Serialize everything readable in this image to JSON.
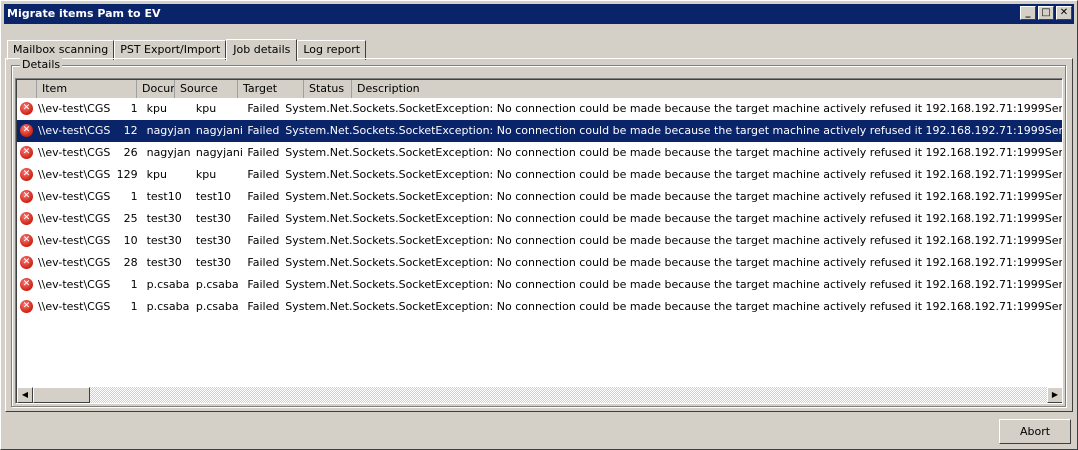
{
  "window": {
    "title": "Migrate items Pam to EV",
    "buttons": {
      "minimize": "_",
      "maximize": "□",
      "close": "✕"
    }
  },
  "tabs": [
    {
      "label": "Mailbox scanning"
    },
    {
      "label": "PST Export/Import"
    },
    {
      "label": "Job details",
      "active": true
    },
    {
      "label": "Log report"
    }
  ],
  "group": {
    "label": "Details"
  },
  "columns": [
    "",
    "Item",
    "Docur",
    "Source",
    "Target",
    "Status",
    "Description"
  ],
  "rows": [
    {
      "item": "\\\\ev-test\\CGShar...",
      "docs": "1",
      "source": "kpu",
      "target": "kpu",
      "status": "Failed",
      "description": "System.Net.Sockets.SocketException: No connection could be made because the target machine actively refused it 192.168.192.71:1999Ser"
    },
    {
      "item": "\\\\ev-test\\CGShar...",
      "docs": "12",
      "source": "nagyjani",
      "target": "nagyjani",
      "status": "Failed",
      "description": "System.Net.Sockets.SocketException: No connection could be made because the target machine actively refused it 192.168.192.71:1999Ser",
      "selected": true
    },
    {
      "item": "\\\\ev-test\\CGShar...",
      "docs": "26",
      "source": "nagyjani",
      "target": "nagyjani",
      "status": "Failed",
      "description": "System.Net.Sockets.SocketException: No connection could be made because the target machine actively refused it 192.168.192.71:1999Ser"
    },
    {
      "item": "\\\\ev-test\\CGShar...",
      "docs": "129",
      "source": "kpu",
      "target": "kpu",
      "status": "Failed",
      "description": "System.Net.Sockets.SocketException: No connection could be made because the target machine actively refused it 192.168.192.71:1999Ser"
    },
    {
      "item": "\\\\ev-test\\CGShar...",
      "docs": "1",
      "source": "test10",
      "target": "test10",
      "status": "Failed",
      "description": "System.Net.Sockets.SocketException: No connection could be made because the target machine actively refused it 192.168.192.71:1999Ser"
    },
    {
      "item": "\\\\ev-test\\CGShar...",
      "docs": "25",
      "source": "test30",
      "target": "test30",
      "status": "Failed",
      "description": "System.Net.Sockets.SocketException: No connection could be made because the target machine actively refused it 192.168.192.71:1999Ser"
    },
    {
      "item": "\\\\ev-test\\CGShar...",
      "docs": "10",
      "source": "test30",
      "target": "test30",
      "status": "Failed",
      "description": "System.Net.Sockets.SocketException: No connection could be made because the target machine actively refused it 192.168.192.71:1999Ser"
    },
    {
      "item": "\\\\ev-test\\CGShar...",
      "docs": "28",
      "source": "test30",
      "target": "test30",
      "status": "Failed",
      "description": "System.Net.Sockets.SocketException: No connection could be made because the target machine actively refused it 192.168.192.71:1999Ser"
    },
    {
      "item": "\\\\ev-test\\CGShar...",
      "docs": "1",
      "source": "p.csaba",
      "target": "p.csaba",
      "status": "Failed",
      "description": "System.Net.Sockets.SocketException: No connection could be made because the target machine actively refused it 192.168.192.71:1999Ser"
    },
    {
      "item": "\\\\ev-test\\CGShar...",
      "docs": "1",
      "source": "p.csaba",
      "target": "p.csaba",
      "status": "Failed",
      "description": "System.Net.Sockets.SocketException: No connection could be made because the target machine actively refused it 192.168.192.71:1999Ser"
    }
  ],
  "icons": {
    "row_status": "error-icon"
  },
  "colors": {
    "titlebar": "#0a246a",
    "selection": "#0a246a",
    "error": "#cc2211"
  },
  "abort_label": "Abort"
}
